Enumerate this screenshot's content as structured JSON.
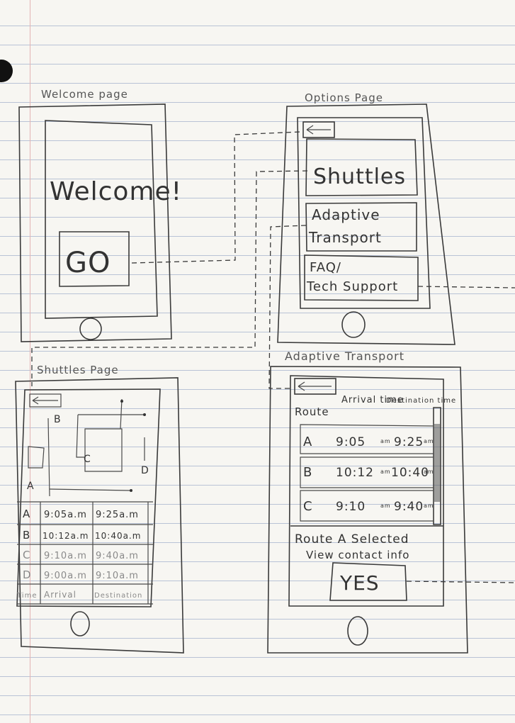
{
  "welcome_page": {
    "label": "Welcome page",
    "heading": "Welcome!",
    "go_button": "GO"
  },
  "options_page": {
    "label": "Options Page",
    "options": [
      {
        "line1": "Shuttles",
        "line2": ""
      },
      {
        "line1": "Adaptive",
        "line2": "Transport"
      },
      {
        "line1": "FAQ/",
        "line2": "Tech Support"
      }
    ]
  },
  "shuttles_page": {
    "label": "Shuttles Page",
    "map_labels": {
      "a": "A",
      "b": "B",
      "c": "C",
      "d": "D"
    },
    "rows": [
      {
        "route": "A",
        "arrival": "9:05a.m",
        "destination": "9:25a.m"
      },
      {
        "route": "B",
        "arrival": "10:12a.m",
        "destination": "10:40a.m"
      },
      {
        "route": "C",
        "arrival": "9:10a.m",
        "destination": "9:40a.m"
      },
      {
        "route": "D",
        "arrival": "9:00a.m",
        "destination": "9:10a.m"
      }
    ],
    "footer": {
      "route": "Time",
      "arrival": "Arrival",
      "destination": "Destination"
    }
  },
  "adaptive_page": {
    "label": "Adaptive Transport",
    "headers": {
      "route": "Route",
      "arrival": "Arrival time",
      "destination": "Destination time"
    },
    "rows": [
      {
        "route": "A",
        "arrival": "9:05",
        "destination": "9:25"
      },
      {
        "route": "B",
        "arrival": "10:12",
        "destination": "10:40"
      },
      {
        "route": "C",
        "arrival": "9:10",
        "destination": "9:40"
      }
    ],
    "am": "am",
    "selected_text": "Route A Selected",
    "contact_text": "View contact info",
    "yes_button": "YES"
  }
}
